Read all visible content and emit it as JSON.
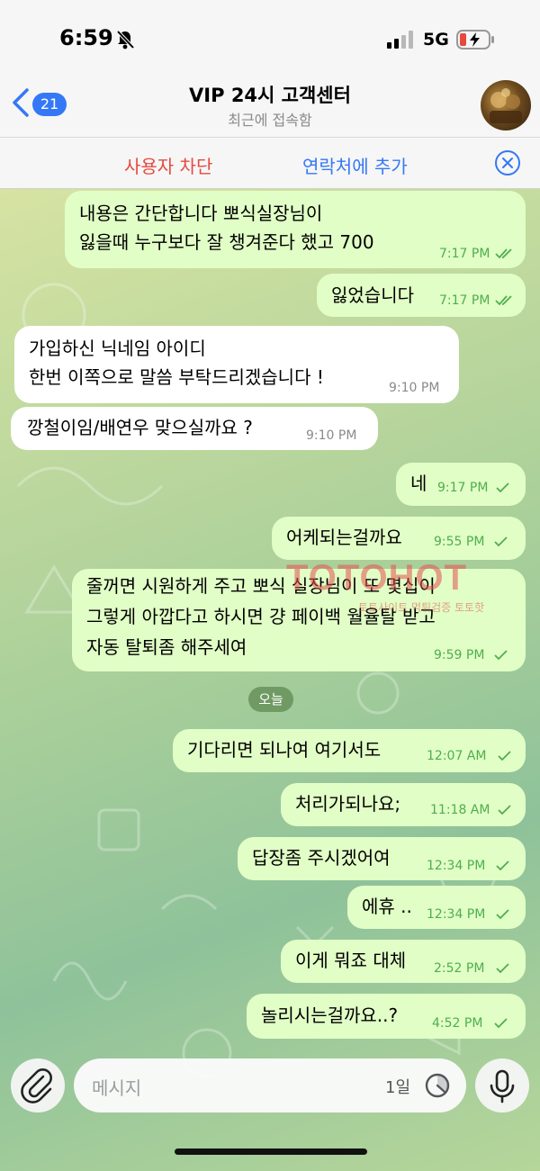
{
  "status_bar": {
    "time": "6:59",
    "network": "5G",
    "icons": [
      "bell-slash-icon",
      "signal-icon",
      "battery-charging-icon"
    ]
  },
  "header": {
    "back_badge": "21",
    "title": "VIP 24시 고객센터",
    "subtitle": "최근에 접속함"
  },
  "action_bar": {
    "block_label": "사용자 차단",
    "add_contact_label": "연락처에 추가"
  },
  "messages": [
    {
      "dir": "out",
      "lines": [
        "내용은 간단합니다 뽀식실장님이",
        "잃을때 누구보다 잘 챙겨준다 했고 700"
      ],
      "time": "7:17 PM",
      "read": true
    },
    {
      "dir": "out",
      "lines": [
        "잃었습니다"
      ],
      "time": "7:17 PM",
      "read": true
    },
    {
      "dir": "in",
      "lines": [
        "가입하신 닉네임 아이디",
        "한번 이쪽으로 말씀 부탁드리겠습니다 !"
      ],
      "time": "9:10 PM"
    },
    {
      "dir": "in",
      "lines": [
        "깡철이임/배연우 맞으실까요 ?"
      ],
      "time": "9:10 PM"
    },
    {
      "dir": "out",
      "lines": [
        "네"
      ],
      "time": "9:17 PM",
      "read": false
    },
    {
      "dir": "out",
      "lines": [
        "어케되는걸까요"
      ],
      "time": "9:55 PM",
      "read": false
    },
    {
      "dir": "out",
      "lines": [
        "줄꺼면 시원하게 주고 뽀식 실장님이 또 몇십이",
        "그렇게 아깝다고 하시면 걍 페이백 월율탈 받고",
        "자동 탈퇴좀 해주세여"
      ],
      "time": "9:59 PM",
      "read": false
    },
    {
      "dir": "out",
      "lines": [
        "기다리면 되나여 여기서도"
      ],
      "time": "12:07 AM",
      "read": false
    },
    {
      "dir": "out",
      "lines": [
        "처리가되나요;"
      ],
      "time": "11:18 AM",
      "read": false
    },
    {
      "dir": "out",
      "lines": [
        "답장좀 주시겠어여"
      ],
      "time": "12:34 PM",
      "read": false
    },
    {
      "dir": "out",
      "lines": [
        "에휴 .."
      ],
      "time": "12:34 PM",
      "read": false
    },
    {
      "dir": "out",
      "lines": [
        "이게 뭐죠 대체"
      ],
      "time": "2:52 PM",
      "read": false
    },
    {
      "dir": "out",
      "lines": [
        "놀리시는걸까요..?"
      ],
      "time": "4:52 PM",
      "read": false
    }
  ],
  "date_separator": "오늘",
  "watermark": {
    "text": "TOTOHOT",
    "sub": "토토사이트 먹튀검증 토토핫"
  },
  "composer": {
    "placeholder": "메시지",
    "timer_label": "1일"
  },
  "colors": {
    "accent": "#3478f6",
    "danger": "#e5493f",
    "outgoing_bubble": "#e1fec6",
    "incoming_bubble": "#ffffff",
    "check": "#4fae4e"
  }
}
